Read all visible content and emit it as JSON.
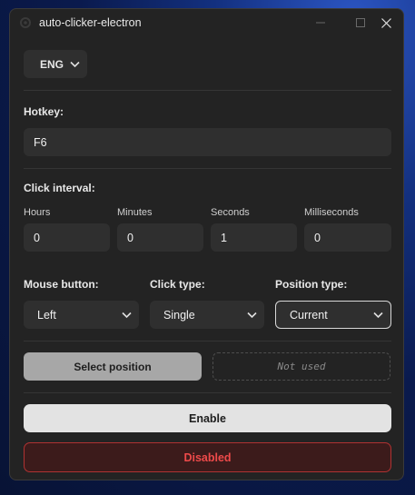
{
  "window": {
    "title": "auto-clicker-electron"
  },
  "language": {
    "selected": "ENG"
  },
  "hotkey": {
    "label": "Hotkey:",
    "value": "F6"
  },
  "interval": {
    "label": "Click interval:",
    "fields": [
      {
        "label": "Hours",
        "value": "0"
      },
      {
        "label": "Minutes",
        "value": "0"
      },
      {
        "label": "Seconds",
        "value": "1"
      },
      {
        "label": "Milliseconds",
        "value": "0"
      }
    ]
  },
  "mouse_button": {
    "label": "Mouse button:",
    "selected": "Left"
  },
  "click_type": {
    "label": "Click type:",
    "selected": "Single"
  },
  "position_type": {
    "label": "Position type:",
    "selected": "Current"
  },
  "position": {
    "select_label": "Select position",
    "status": "Not used"
  },
  "actions": {
    "enable_label": "Enable",
    "status_label": "Disabled"
  },
  "colors": {
    "window_bg": "#232323",
    "field_bg": "#2f2f2f",
    "enable_bg": "#e3e3e3",
    "disabled_border": "#b03232",
    "disabled_text": "#ee4a4a"
  },
  "icons": [
    "app-icon",
    "minimize-icon",
    "maximize-icon",
    "close-icon",
    "chevron-down-icon"
  ]
}
